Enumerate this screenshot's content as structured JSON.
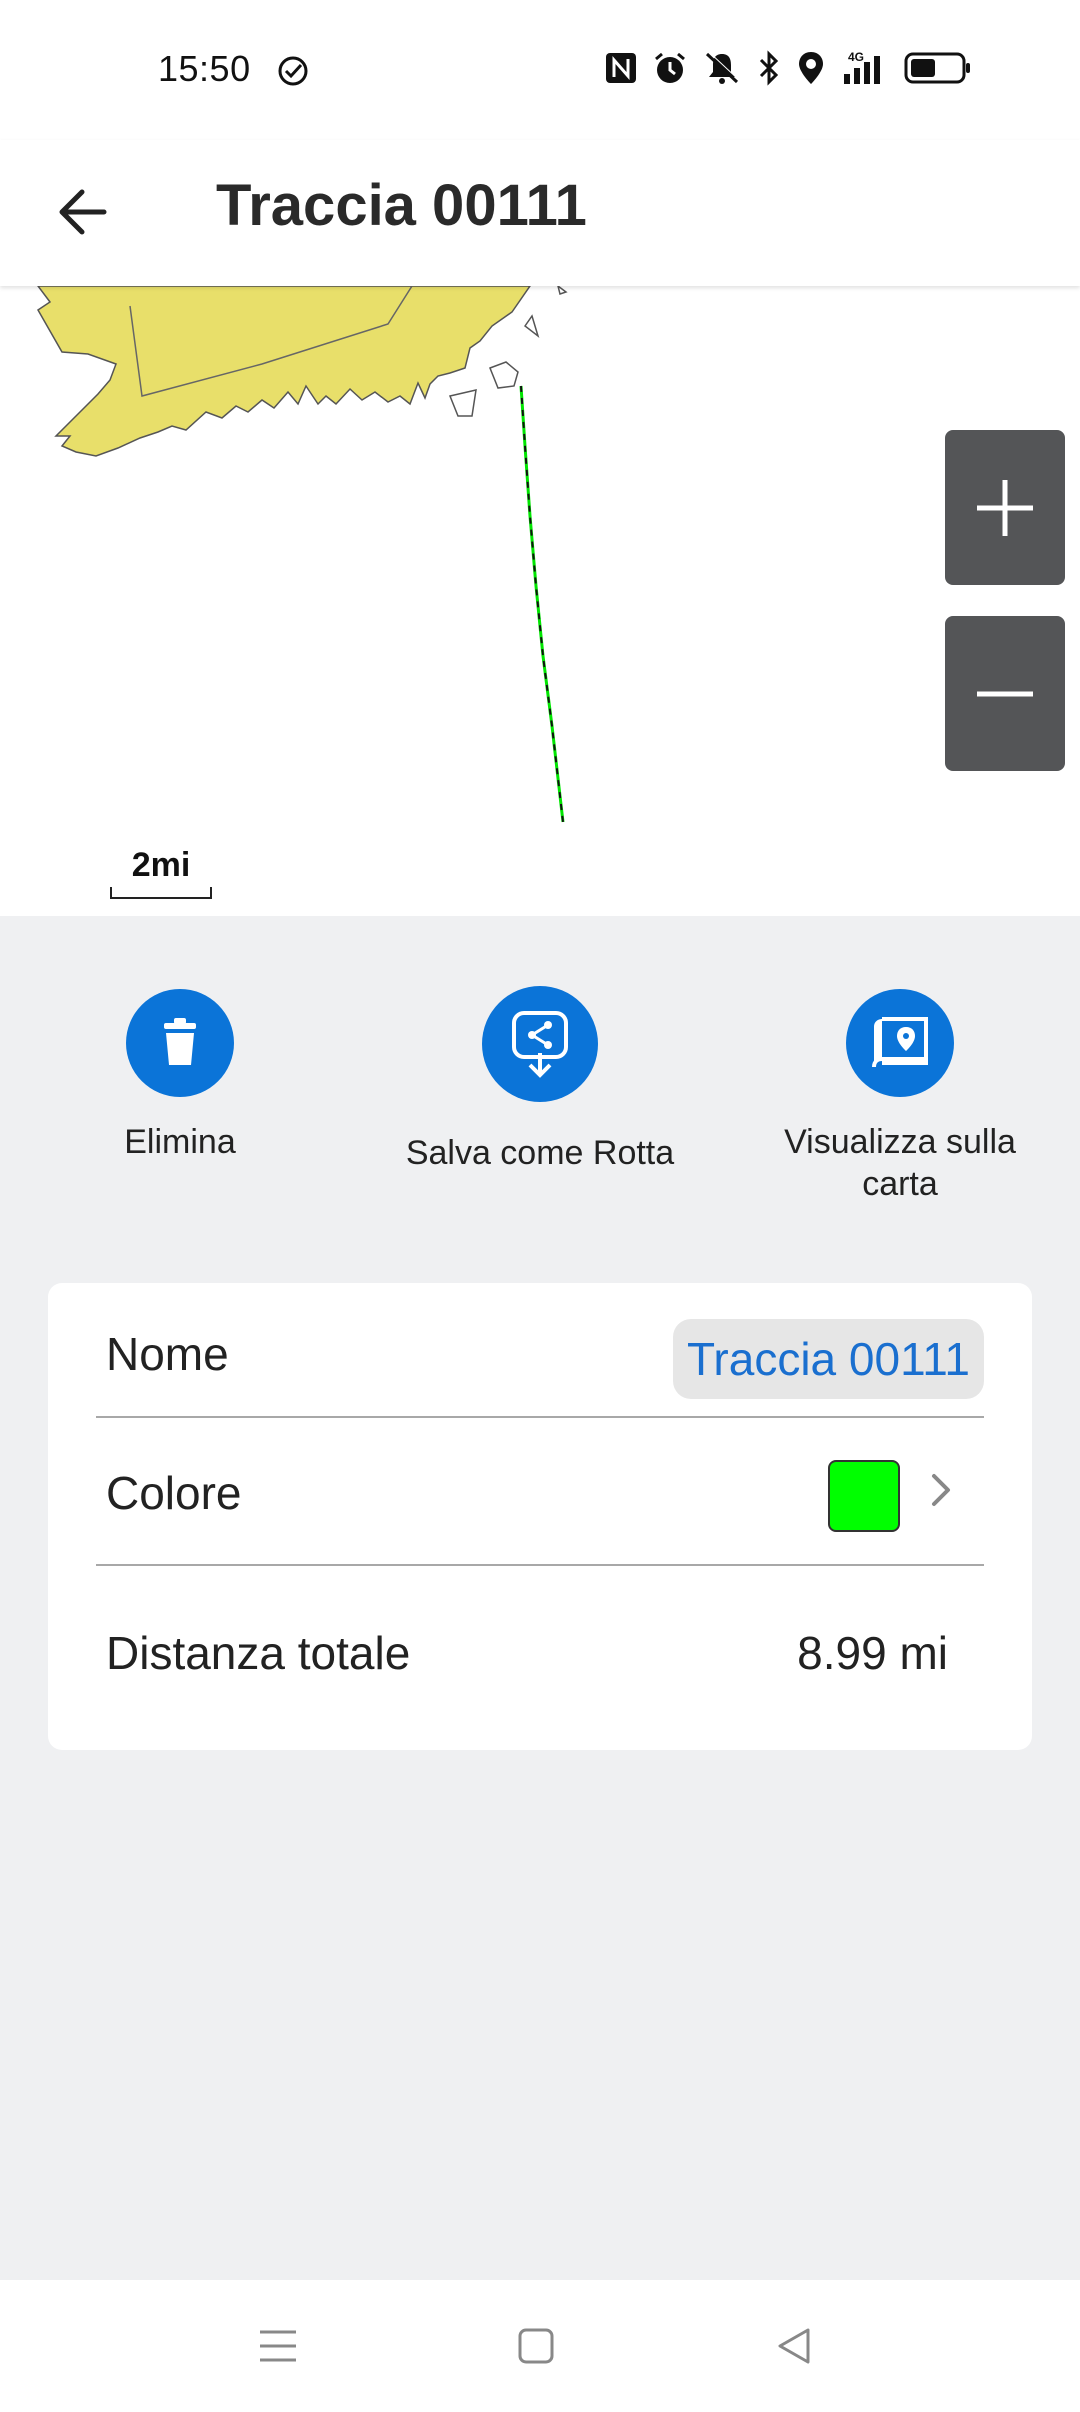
{
  "status_bar": {
    "time": "15:50",
    "network": "4G"
  },
  "header": {
    "title": "Traccia 00111"
  },
  "map": {
    "scale_label": "2mi",
    "land_color": "#e8df6a",
    "track_color": "#00e600"
  },
  "actions": [
    {
      "label": "Elimina",
      "icon": "trash-icon"
    },
    {
      "label": "Salva come Rotta",
      "icon": "save-route-icon"
    },
    {
      "label": "Visualizza sulla carta",
      "icon": "map-pin-icon"
    }
  ],
  "details": {
    "name_label": "Nome",
    "name_value": "Traccia 00111",
    "color_label": "Colore",
    "color_value": "#00ff00",
    "distance_label": "Distanza totale",
    "distance_value": "8.99 mi"
  },
  "colors": {
    "accent": "#0b74d8",
    "background": "#eff0f2",
    "zoom_button": "#545557"
  }
}
